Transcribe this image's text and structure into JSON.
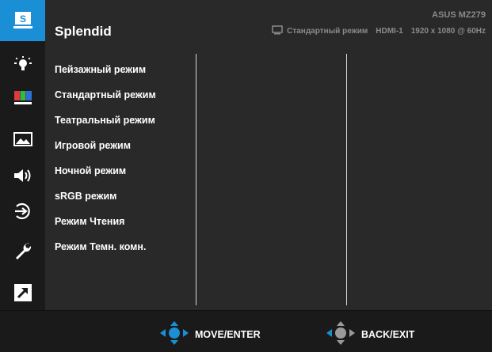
{
  "header": {
    "title": "Splendid",
    "model": "ASUS MZ279",
    "status_mode": "Стандартный режим",
    "status_input": "HDMI-1",
    "status_resolution": "1920 x 1080 @ 60Hz"
  },
  "sidebar": {
    "items": [
      {
        "icon": "splendid-icon",
        "label": "S"
      },
      {
        "icon": "blue-light-filter-icon"
      },
      {
        "icon": "color-icon"
      },
      {
        "icon": "image-icon"
      },
      {
        "icon": "sound-icon"
      },
      {
        "icon": "input-select-icon"
      },
      {
        "icon": "system-setup-icon"
      },
      {
        "icon": "shortcut-icon"
      }
    ]
  },
  "menu": {
    "items": [
      "Пейзажный режим",
      "Стандартный режим",
      "Театральный режим",
      "Игровой режим",
      "Ночной режим",
      "sRGB режим",
      "Режим Чтения",
      "Режим Темн. комн."
    ]
  },
  "footer": {
    "move_enter": "MOVE/ENTER",
    "back_exit": "BACK/EXIT"
  },
  "colors": {
    "accent": "#1b8fd6",
    "background": "#292929",
    "sidebar": "#1a1a1a",
    "text": "#ffffff",
    "muted": "#8a8a8a"
  }
}
